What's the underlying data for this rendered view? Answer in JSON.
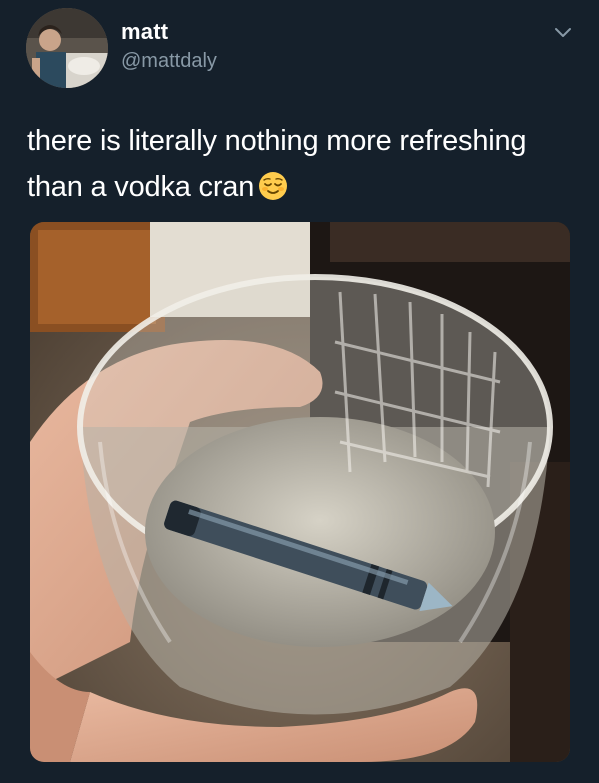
{
  "tweet": {
    "author": {
      "display_name": "matt",
      "handle": "@mattdaly",
      "avatar_icon": "profile-photo"
    },
    "menu_icon": "chevron-down-icon",
    "text_line1": "there is literally nothing more refreshing",
    "text_line2": "than a vodka cran",
    "emoji": "relieved-face-emoji",
    "media": {
      "type": "photo",
      "subject": "hand holding clear glass of water with crayon inside"
    }
  },
  "colors": {
    "background": "#15202b",
    "text_primary": "#ffffff",
    "text_secondary": "#8899a6"
  }
}
